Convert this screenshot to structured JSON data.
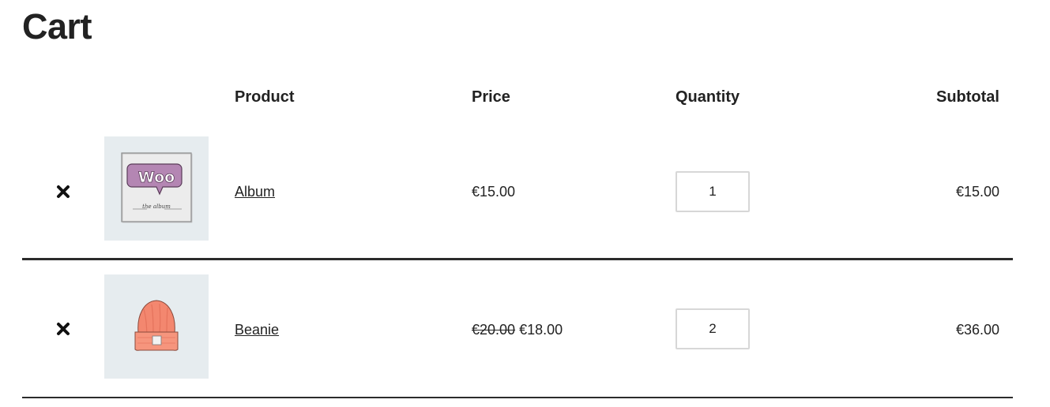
{
  "page": {
    "title": "Cart"
  },
  "table": {
    "headers": {
      "product": "Product",
      "price": "Price",
      "quantity": "Quantity",
      "subtotal": "Subtotal"
    },
    "rows": [
      {
        "remove_icon": "close-icon",
        "thumbnail": "album-woo-image",
        "thumbnail_text": "Woo",
        "thumbnail_caption": "the album",
        "product_name": "Album",
        "price_regular": "",
        "price_current": "€15.00",
        "quantity": "1",
        "subtotal": "€15.00"
      },
      {
        "remove_icon": "close-icon",
        "thumbnail": "beanie-image",
        "product_name": "Beanie",
        "price_regular": "€20.00",
        "price_current": "€18.00",
        "quantity": "2",
        "subtotal": "€36.00"
      }
    ]
  },
  "colors": {
    "text": "#222222",
    "thumb_bg": "#e6ecef",
    "divider": "#2b2b2b",
    "input_border": "#d7d7d7",
    "woo_purple": "#9b5c8f",
    "beanie": "#f0836f"
  }
}
